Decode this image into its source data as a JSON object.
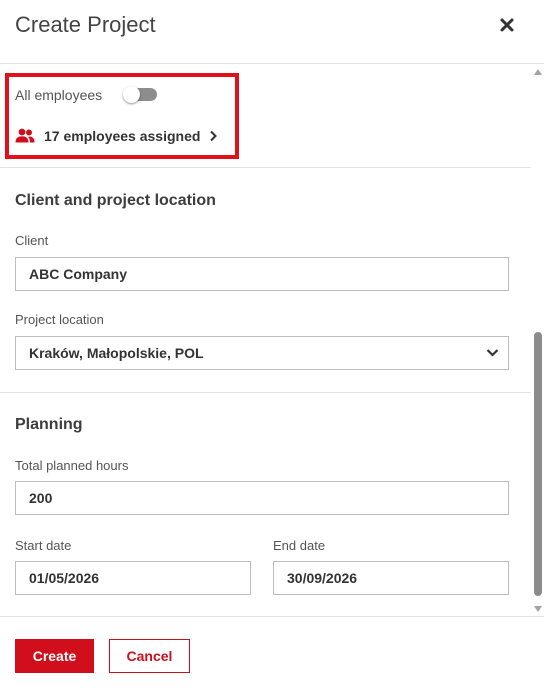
{
  "dialog": {
    "title": "Create Project",
    "close_icon": "close-icon"
  },
  "assignment": {
    "all_employees_label": "All employees",
    "all_employees_enabled": false,
    "employees_link": "17 employees assigned",
    "people_icon": "people-icon",
    "chevron_icon": "chevron-right-icon"
  },
  "client_section": {
    "title": "Client and project location",
    "client_label": "Client",
    "client_value": "ABC Company",
    "location_label": "Project location",
    "location_value": "Kraków, Małopolskie, POL",
    "location_dropdown_icon": "chevron-down-icon"
  },
  "planning": {
    "title": "Planning",
    "hours_label": "Total planned hours",
    "hours_value": "200",
    "start_label": "Start date",
    "start_value": "01/05/2026",
    "end_label": "End date",
    "end_value": "30/09/2026"
  },
  "footer": {
    "create_label": "Create",
    "cancel_label": "Cancel"
  },
  "colors": {
    "accent": "#d10f1c",
    "highlight_border": "#e0101c",
    "toggle_off": "#8d8d8d",
    "text": "#333333"
  }
}
